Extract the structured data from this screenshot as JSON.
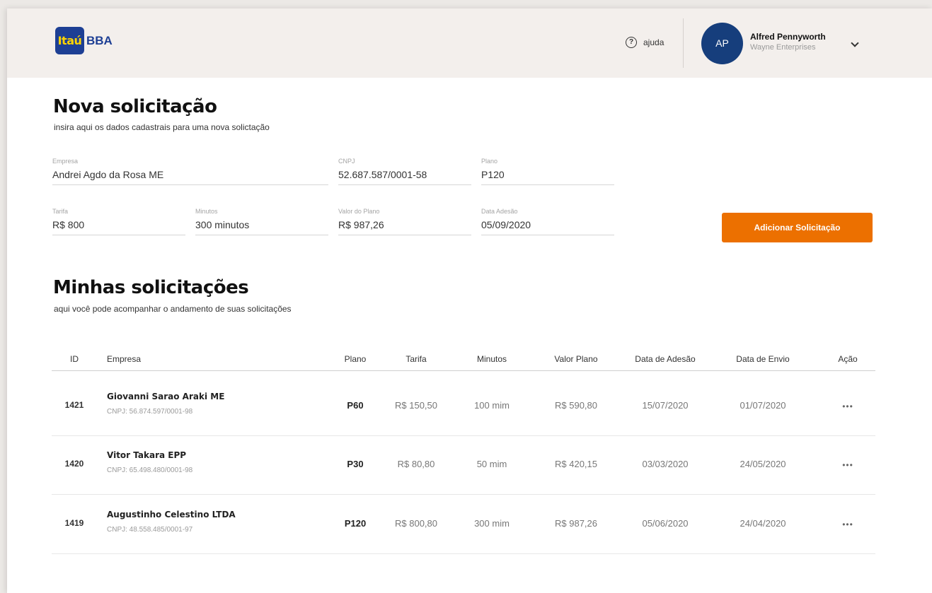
{
  "header": {
    "logo": {
      "badge": "Itaú",
      "text": "BBA"
    },
    "help_label": "ajuda",
    "user": {
      "initials": "AP",
      "name": "Alfred Pennyworth",
      "company": "Wayne Enterprises"
    }
  },
  "new_request": {
    "title": "Nova solicitação",
    "subtitle": "insira aqui os dados cadastrais para uma nova solictação",
    "fields": {
      "empresa": {
        "label": "Empresa",
        "value": "Andrei Agdo da Rosa ME"
      },
      "cnpj": {
        "label": "CNPJ",
        "value": "52.687.587/0001-58"
      },
      "plano": {
        "label": "Plano",
        "value": "P120"
      },
      "tarifa": {
        "label": "Tarifa",
        "value": "R$ 800"
      },
      "minutos": {
        "label": "Minutos",
        "value": "300 minutos"
      },
      "valor_plano": {
        "label": "Valor do Plano",
        "value": "R$ 987,26"
      },
      "data_adesao": {
        "label": "Data Adesão",
        "value": "05/09/2020"
      }
    },
    "submit_label": "Adicionar Solicitação"
  },
  "my_requests": {
    "title": "Minhas solicitações",
    "subtitle": "aqui você pode acompanhar o andamento de suas solicitações",
    "columns": [
      "ID",
      "Empresa",
      "Plano",
      "Tarifa",
      "Minutos",
      "Valor Plano",
      "Data de Adesão",
      "Data de Envio",
      "Ação"
    ],
    "rows": [
      {
        "id": "1421",
        "empresa": "Giovanni Sarao Araki ME",
        "cnpj": "CNPJ: 56.874.597/0001-98",
        "plano": "P60",
        "tarifa": "R$ 150,50",
        "minutos": "100 mim",
        "valor": "R$ 590,80",
        "adesao": "15/07/2020",
        "envio": "01/07/2020",
        "acao": "•••"
      },
      {
        "id": "1420",
        "empresa": "Vitor Takara EPP",
        "cnpj": "CNPJ: 65.498.480/0001-98",
        "plano": "P30",
        "tarifa": "R$ 80,80",
        "minutos": "50 mim",
        "valor": "R$ 420,15",
        "adesao": "03/03/2020",
        "envio": "24/05/2020",
        "acao": "•••"
      },
      {
        "id": "1419",
        "empresa": "Augustinho Celestino LTDA",
        "cnpj": "CNPJ: 48.558.485/0001-97",
        "plano": "P120",
        "tarifa": "R$ 800,80",
        "minutos": "300 mim",
        "valor": "R$ 987,26",
        "adesao": "05/06/2020",
        "envio": "24/04/2020",
        "acao": "•••"
      }
    ]
  },
  "colors": {
    "brand_blue": "#1d3f94",
    "brand_yellow": "#ffd400",
    "accent_orange": "#ec7000",
    "header_bg": "#f3efec",
    "avatar_bg": "#163e7c"
  }
}
